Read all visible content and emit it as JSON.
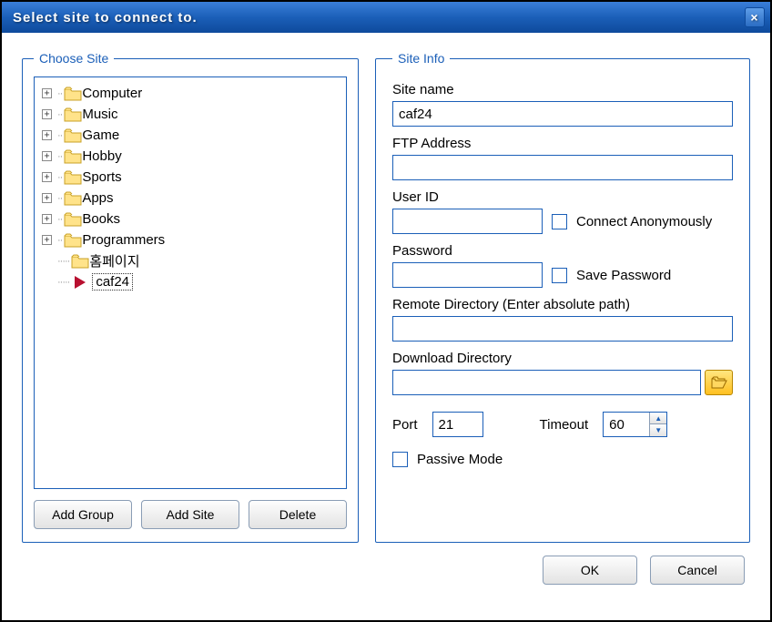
{
  "titlebar": {
    "title": "Select site to connect to.",
    "close": "×"
  },
  "choose_site": {
    "legend": "Choose Site",
    "items": [
      {
        "label": "Computer",
        "expandable": true
      },
      {
        "label": "Music",
        "expandable": true
      },
      {
        "label": "Game",
        "expandable": true
      },
      {
        "label": "Hobby",
        "expandable": true
      },
      {
        "label": "Sports",
        "expandable": true
      },
      {
        "label": "Apps",
        "expandable": true
      },
      {
        "label": "Books",
        "expandable": true
      },
      {
        "label": "Programmers",
        "expandable": true
      }
    ],
    "leaf1": "홈페이지",
    "leaf2": "caf24",
    "buttons": {
      "add_group": "Add Group",
      "add_site": "Add Site",
      "delete": "Delete"
    }
  },
  "site_info": {
    "legend": "Site Info",
    "site_name_label": "Site name",
    "site_name_value": "caf24",
    "ftp_address_label": "FTP Address",
    "ftp_address_value": "",
    "user_id_label": "User ID",
    "user_id_value": "",
    "connect_anon_label": "Connect Anonymously",
    "password_label": "Password",
    "password_value": "",
    "save_password_label": "Save Password",
    "remote_dir_label": "Remote Directory (Enter absolute path)",
    "remote_dir_value": "",
    "download_dir_label": "Download Directory",
    "download_dir_value": "",
    "port_label": "Port",
    "port_value": "21",
    "timeout_label": "Timeout",
    "timeout_value": "60",
    "passive_label": "Passive Mode"
  },
  "bottom": {
    "ok": "OK",
    "cancel": "Cancel"
  }
}
